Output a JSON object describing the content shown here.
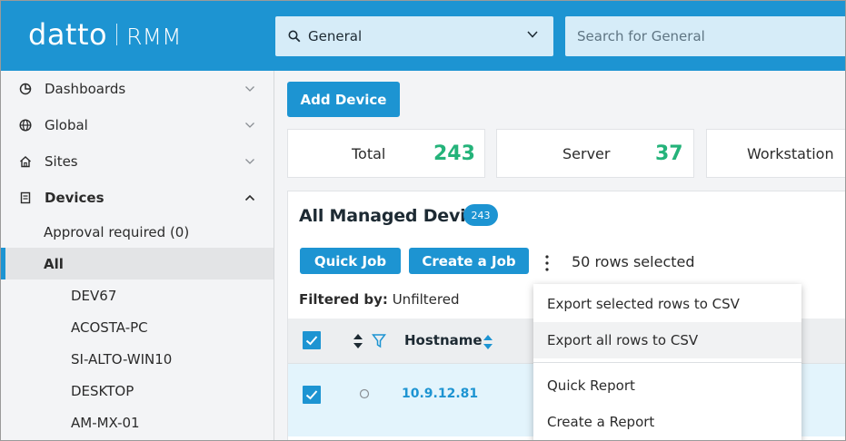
{
  "header": {
    "brand": "datto",
    "product": "RMM",
    "scope_label": "General",
    "search_placeholder": "Search for General"
  },
  "sidebar": {
    "nav": [
      {
        "label": "Dashboards",
        "icon": "pie-chart-icon",
        "expanded": false
      },
      {
        "label": "Global",
        "icon": "globe-icon",
        "expanded": false
      },
      {
        "label": "Sites",
        "icon": "home-icon",
        "expanded": false
      },
      {
        "label": "Devices",
        "icon": "device-list-icon",
        "expanded": true
      }
    ],
    "devices_sub": [
      {
        "label": "Approval required (0)"
      },
      {
        "label": "All",
        "active": true
      }
    ],
    "device_list": [
      "DEV67",
      "ACOSTA-PC",
      "SI-ALTO-WIN10",
      "DESKTOP",
      "AM-MX-01"
    ]
  },
  "main": {
    "add_device_label": "Add Device",
    "stats": [
      {
        "label": "Total",
        "value": "243"
      },
      {
        "label": "Server",
        "value": "37"
      },
      {
        "label": "Workstation",
        "value": ""
      }
    ],
    "panel": {
      "title": "All Managed Devices",
      "count": "243",
      "quick_job_label": "Quick Job",
      "create_job_label": "Create a Job",
      "rows_selected": "50 rows selected",
      "filtered_label": "Filtered by:",
      "filtered_value": "Unfiltered",
      "column_hostname": "Hostname",
      "row_host": "10.9.12.81"
    }
  },
  "menu": {
    "items": [
      {
        "label": "Export selected rows to CSV"
      },
      {
        "label": "Export all rows to CSV",
        "hover": true
      },
      {
        "label": "Quick Report"
      },
      {
        "label": "Create a Report"
      }
    ]
  },
  "colors": {
    "brand_blue": "#1d94d2",
    "stat_green": "#24b37a",
    "row_selected": "#e3f4fc"
  }
}
